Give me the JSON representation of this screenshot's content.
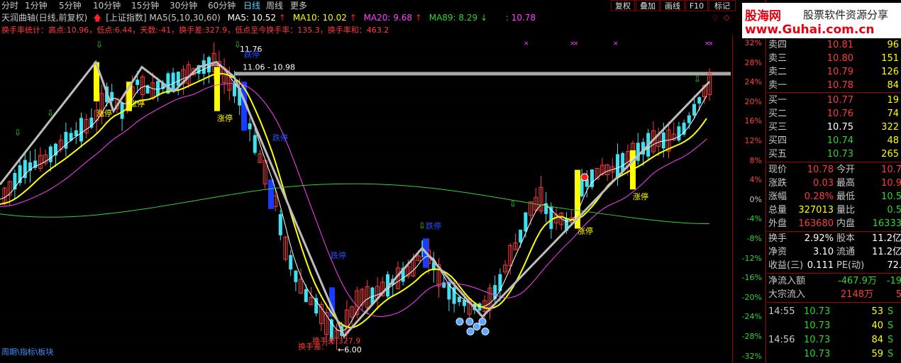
{
  "tabs": [
    "分时",
    "1分钟",
    "5分钟",
    "10分钟",
    "15分钟",
    "30分钟",
    "60分钟",
    "日线",
    "周线",
    "更多"
  ],
  "active_tab": "日线",
  "toolbar": [
    "复权",
    "叠加",
    "画线",
    "F10",
    "标记"
  ],
  "title": {
    "stock": "天润曲轴(日线,前复权)",
    "index": "[上证指数]",
    "ma_group": "MA5(5,10,30,60)",
    "ma5": "MA5: 10.52",
    "ma10": "MA10: 10.02",
    "ma20": "MA20: 9.68",
    "ma89": "MA89: 8.29",
    "extra": ": 10.78"
  },
  "stats_line": "换手率统计：高点:10.96，低点:6.44，天数:-41，换手差:327.9，低点至今换手率：135.3，换手率和：463.2",
  "logo": {
    "line1": "股海网",
    "line2": "股票软件资源分享",
    "line3": "www.Guhai.com.cn"
  },
  "y_axis": [
    "32%",
    "28%",
    "24%",
    "20%",
    "16%",
    "12%",
    "8%",
    "4%",
    "0%",
    "-4%",
    "-8%",
    "-12%",
    "-16%",
    "-20%",
    "-24%",
    "-28%",
    "-32%"
  ],
  "chart_labels": {
    "high_price": "11.76",
    "range": "11.06 - 10.98",
    "low_price": "6.00",
    "turnover_diff": "换手差:327.9",
    "turnover_diff2": "换手差:",
    "limit_up": "涨停",
    "limit_down": "跌停",
    "bottom_link": "周期\\指标\\板块"
  },
  "order_book": [
    {
      "label": "卖四",
      "price": "10.81",
      "vol": "96"
    },
    {
      "label": "卖三",
      "price": "10.80",
      "vol": "151"
    },
    {
      "label": "卖二",
      "price": "10.79",
      "vol": "126"
    },
    {
      "label": "卖一",
      "price": "10.78",
      "vol": "84"
    },
    {
      "label": "买一",
      "price": "10.77",
      "vol": "19"
    },
    {
      "label": "买二",
      "price": "10.76",
      "vol": "74"
    },
    {
      "label": "买三",
      "price": "10.75",
      "vol": "322"
    },
    {
      "label": "买四",
      "price": "10.74",
      "vol": "48"
    },
    {
      "label": "买五",
      "price": "10.73",
      "vol": "265"
    }
  ],
  "quote": [
    {
      "l1": "现价",
      "v1": "10.78",
      "l2": "今开",
      "v2": "10.7"
    },
    {
      "l1": "涨跌",
      "v1": "0.03",
      "l2": "最高",
      "v2": "10.9"
    },
    {
      "l1": "涨幅",
      "v1": "0.28%",
      "l2": "最低",
      "v2": "10.5"
    },
    {
      "l1": "总量",
      "v1": "327013",
      "l2": "量比",
      "v2": "0.5"
    },
    {
      "l1": "外盘",
      "v1": "163680",
      "l2": "内盘",
      "v2": "16333"
    },
    {
      "l1": "换手",
      "v1": "2.92%",
      "l2": "股本",
      "v2": "11.2亿"
    },
    {
      "l1": "净资",
      "v1": "3.10",
      "l2": "流通",
      "v2": "11.2亿"
    },
    {
      "l1": "收益(三)",
      "v1": "0.111",
      "l2": "PE(动)",
      "v2": "72."
    }
  ],
  "flow": [
    {
      "label": "净流入额",
      "value": "-467.9万",
      "extra": "-19"
    },
    {
      "label": "大宗流入",
      "value": "2148万",
      "extra": "5"
    }
  ],
  "ticks": [
    {
      "time": "14:55",
      "price": "10.73",
      "qty": "53",
      "side": "S"
    },
    {
      "time": "",
      "price": "10.73",
      "qty": "40",
      "side": "S"
    },
    {
      "time": "14:56",
      "price": "10.73",
      "qty": "84",
      "side": "S"
    },
    {
      "time": "",
      "price": "10.73",
      "qty": "59",
      "side": "S"
    },
    {
      "time": "",
      "price": "10.73",
      "qty": "35",
      "side": "S"
    }
  ],
  "colors": {
    "up": "#ff3b3b",
    "down": "#32d232",
    "ma5": "#ffffff",
    "ma10": "#ffff00",
    "ma20": "#ff40ff",
    "ma89": "#32d232",
    "limit_up": "#ffff00",
    "limit_down": "#1a3cff"
  }
}
